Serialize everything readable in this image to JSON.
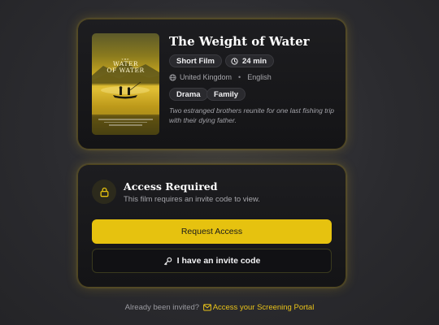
{
  "film": {
    "title": "The Weight of Water",
    "type_label": "Short Film",
    "duration": "24 min",
    "country": "United Kingdom",
    "language": "English",
    "genres": [
      "Drama",
      "Family"
    ],
    "synopsis": "Two estranged brothers reunite for one last fishing trip with their dying father.",
    "poster": {
      "pre_title": "THE",
      "title_line1": "WATER",
      "title_line2": "OF WATER"
    }
  },
  "access": {
    "title": "Access Required",
    "subtitle": "This film requires an invite code to view.",
    "request_label": "Request Access",
    "invite_label": "I have an invite code"
  },
  "footer": {
    "prompt": "Already been invited?",
    "link_label": "Access your Screening Portal"
  },
  "colors": {
    "accent": "#e6c20f",
    "card_bg": "#161618",
    "page_bg": "#2b2b2f"
  },
  "icons": {
    "duration": "clock-icon",
    "country": "globe-icon",
    "access": "lock-icon",
    "invite": "key-icon",
    "footer": "mail-icon"
  }
}
